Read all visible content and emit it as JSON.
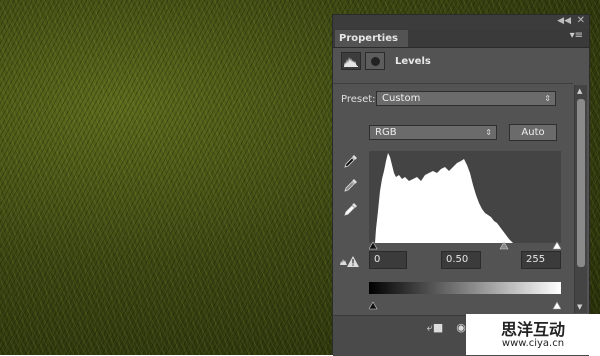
{
  "panel": {
    "tab_title": "Properties",
    "header_title": "Levels"
  },
  "preset": {
    "label": "Preset:",
    "value": "Custom"
  },
  "channel": {
    "value": "RGB"
  },
  "auto_label": "Auto",
  "input_levels": {
    "black": "0",
    "midtone": "0.50",
    "white": "255"
  },
  "watermark": {
    "line1": "思洋互动",
    "line2": "www.ciya.cn"
  },
  "icons": {
    "collapse": "collapse-double-arrow-icon",
    "close": "close-icon",
    "panel_menu": "panel-menu-icon",
    "levels_adjustment": "histogram-icon",
    "mask": "mask-icon",
    "black_point": "eyedropper-black-icon",
    "gray_point": "eyedropper-gray-icon",
    "white_point": "eyedropper-white-icon",
    "clipping_warning": "clipping-warning-icon",
    "clip_to_layer": "clip-to-layer-icon",
    "visibility": "eye-icon"
  },
  "colors": {
    "panel_bg": "#535353",
    "histogram_bg": "#444444",
    "histogram_fill": "#ffffff"
  }
}
